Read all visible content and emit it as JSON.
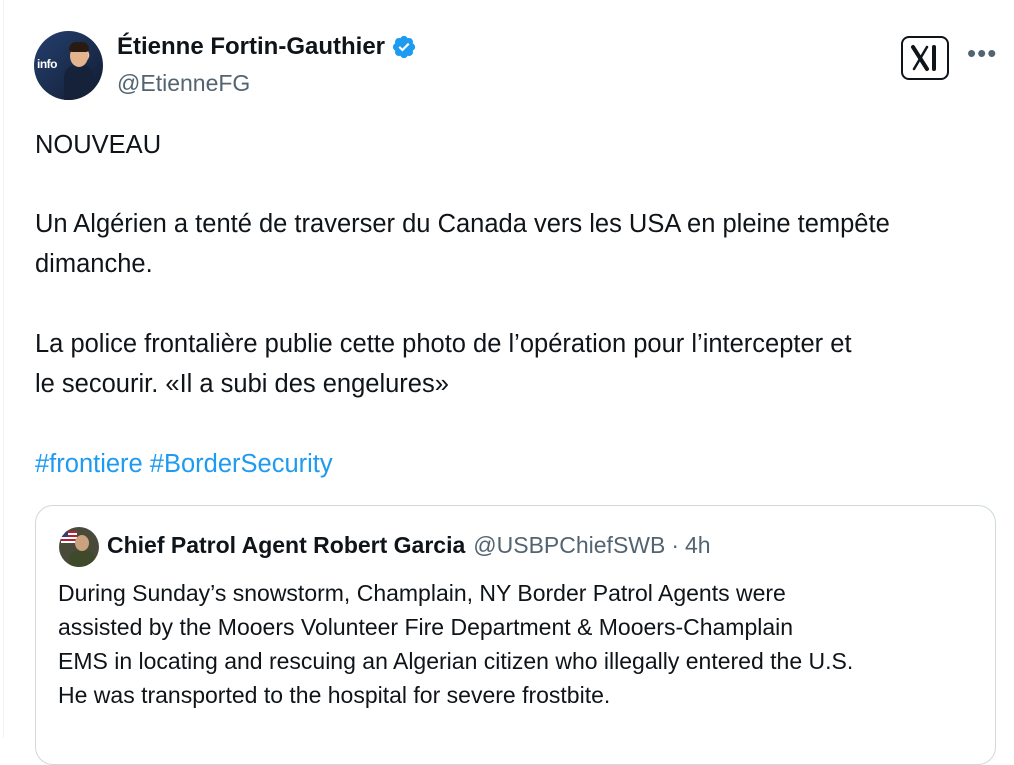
{
  "author": {
    "name": "Étienne Fortin-Gauthier",
    "handle": "@EtienneFG",
    "avatar_logo_text": "info"
  },
  "icons": {
    "verified": "verified-badge-icon",
    "platform": "x-logo-icon",
    "more": "more-options-icon"
  },
  "post": {
    "line1": "NOUVEAU",
    "line2a": "Un Algérien a tenté de traverser du Canada vers les USA en pleine tempête",
    "line2b": "dimanche.",
    "line3a": "La police frontalière publie cette photo de l’opération pour l’intercepter et",
    "line3b": "le secourir. «Il a subi des engelures»",
    "hashtags": "#frontiere #BorderSecurity"
  },
  "quoted": {
    "name": "Chief Patrol Agent Robert Garcia",
    "handle": "@USBPChiefSWB",
    "separator": "·",
    "time": "4h",
    "line1": "During Sunday’s snowstorm, Champlain, NY Border Patrol Agents were",
    "line2": "assisted by the Mooers Volunteer Fire Department & Mooers-Champlain",
    "line3": "EMS in locating and rescuing an Algerian citizen who illegally entered the U.S.",
    "line4": "He was transported to the hospital for severe frostbite."
  },
  "colors": {
    "text": "#0f1419",
    "secondary": "#536471",
    "link": "#1d9bf0",
    "verified": "#1d9bf0",
    "border": "#cfd9de"
  }
}
